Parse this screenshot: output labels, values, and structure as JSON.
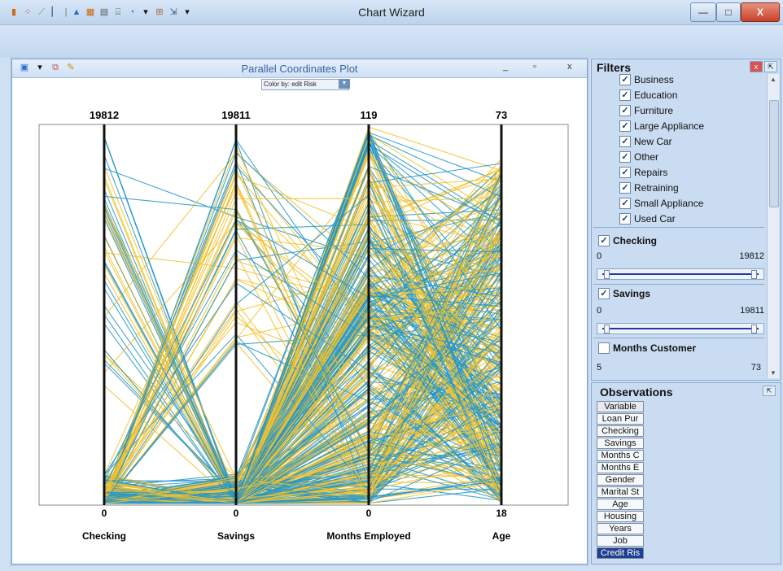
{
  "window": {
    "title": "Chart Wizard",
    "controls": {
      "minimize": "—",
      "maximize": "□",
      "close": "X"
    }
  },
  "plot_window": {
    "title": "Parallel Coordinates Plot",
    "color_by": "Color by: edit Risk"
  },
  "colors": {
    "series_a": "#f2c12e",
    "series_b": "#2596c8",
    "axis": "#111111"
  },
  "chart_data": {
    "type": "parallel_coordinates",
    "axes": [
      {
        "label": "Checking",
        "min": 0,
        "max": 19812
      },
      {
        "label": "Savings",
        "min": 0,
        "max": 19811
      },
      {
        "label": "Months Employed",
        "min": 0,
        "max": 119
      },
      {
        "label": "Age",
        "min": 18,
        "max": 73
      }
    ],
    "axis_labels": [
      "Checking",
      "Savings",
      "Months Employed",
      "Age"
    ],
    "axis_max_labels": [
      "19812",
      "19811",
      "119",
      "73"
    ],
    "axis_min_labels": [
      "0",
      "0",
      "0",
      "18"
    ],
    "series_colors": [
      "#f2c12e",
      "#2596c8"
    ]
  },
  "filters": {
    "title": "Filters",
    "categories": [
      {
        "label": "Business",
        "checked": true
      },
      {
        "label": "Education",
        "checked": true
      },
      {
        "label": "Furniture",
        "checked": true
      },
      {
        "label": "Large Appliance",
        "checked": true
      },
      {
        "label": "New Car",
        "checked": true
      },
      {
        "label": "Other",
        "checked": true
      },
      {
        "label": "Repairs",
        "checked": true
      },
      {
        "label": "Retraining",
        "checked": true
      },
      {
        "label": "Small Appliance",
        "checked": true
      },
      {
        "label": "Used Car",
        "checked": true
      }
    ],
    "checking": {
      "label": "Checking",
      "checked": true,
      "min": "0",
      "max": "19812"
    },
    "savings": {
      "label": "Savings",
      "checked": true,
      "min": "0",
      "max": "19811"
    },
    "months_customer": {
      "label": "Months Customer",
      "checked": false,
      "min": "5",
      "max": "73"
    }
  },
  "observations": {
    "title": "Observations",
    "items": [
      "Variable",
      "Loan Pur",
      "Checking",
      "Savings",
      "Months C",
      "Months E",
      "Gender",
      "Marital St",
      "Age",
      "Housing",
      "Years",
      "Job",
      "Credit Ris"
    ]
  }
}
